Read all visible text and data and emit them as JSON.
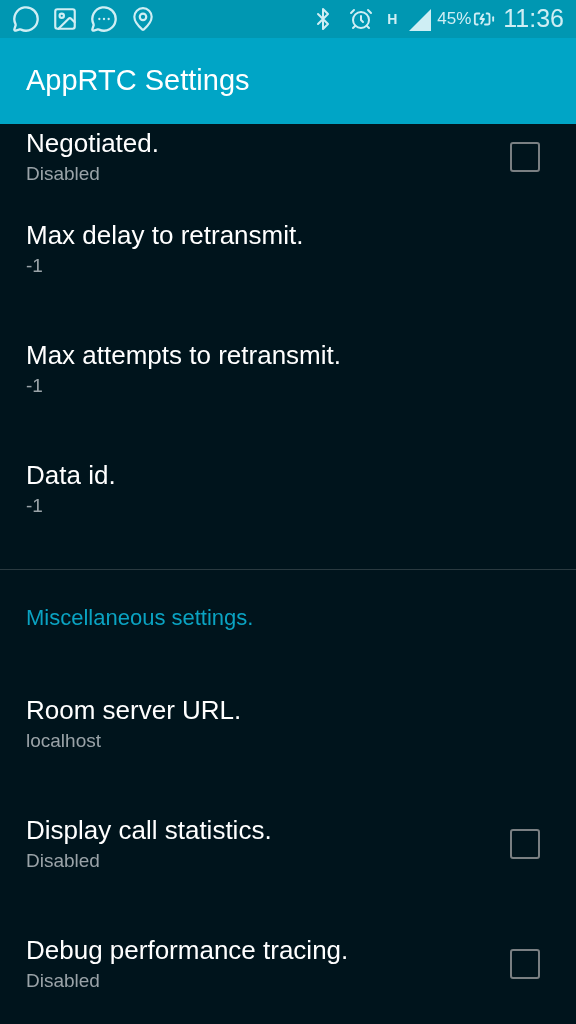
{
  "status_bar": {
    "network_type": "H",
    "battery_percent": "45%",
    "time": "11:36"
  },
  "app_bar": {
    "title": "AppRTC Settings"
  },
  "sections": [
    {
      "items": [
        {
          "kind": "checkbox",
          "title": "Negotiated.",
          "summary": "Disabled",
          "checked": false
        },
        {
          "kind": "text",
          "title": "Max delay to retransmit.",
          "summary": "-1"
        },
        {
          "kind": "text",
          "title": "Max attempts to retransmit.",
          "summary": "-1"
        },
        {
          "kind": "text",
          "title": "Data id.",
          "summary": "-1"
        }
      ]
    },
    {
      "heading": "Miscellaneous settings.",
      "items": [
        {
          "kind": "text",
          "title": "Room server URL.",
          "summary": "localhost"
        },
        {
          "kind": "checkbox",
          "title": "Display call statistics.",
          "summary": "Disabled",
          "checked": false
        },
        {
          "kind": "checkbox",
          "title": "Debug performance tracing.",
          "summary": "Disabled",
          "checked": false
        }
      ]
    }
  ]
}
